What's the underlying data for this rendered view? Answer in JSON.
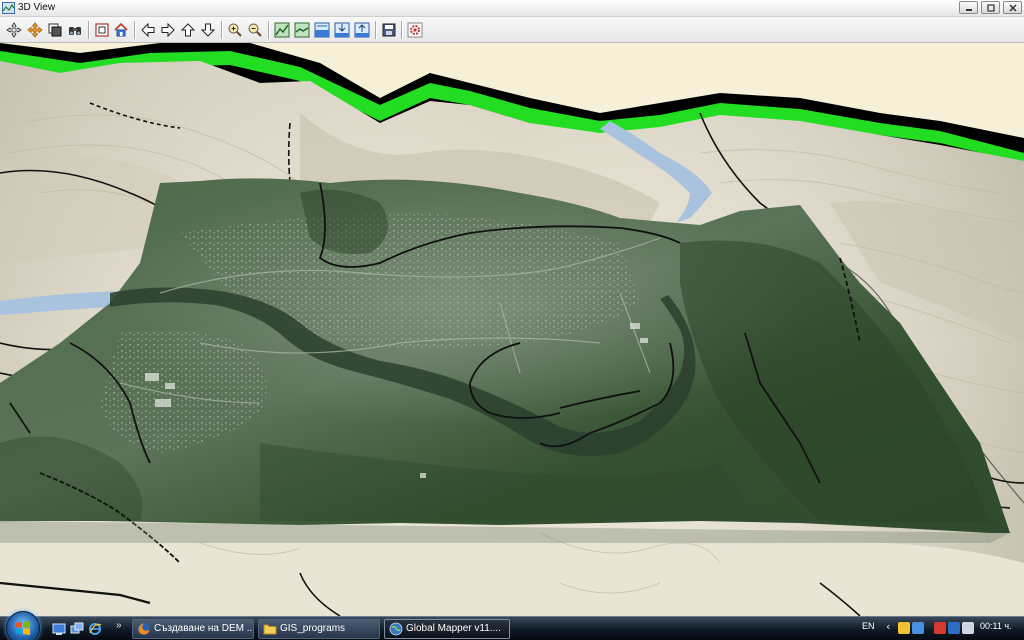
{
  "window": {
    "title": "3D View",
    "controls": [
      "minimize",
      "maximize",
      "close"
    ]
  },
  "toolbar": {
    "buttons": [
      {
        "name": "pan-tool-button",
        "icon": "arrows-move-icon"
      },
      {
        "name": "move-tool-button",
        "icon": "cross-arrows-icon"
      },
      {
        "name": "copy-view-button",
        "icon": "copy-icon"
      },
      {
        "name": "binoculars-button",
        "icon": "binoculars-icon"
      },
      {
        "name": "zoom-extent-button",
        "icon": "zoom-box-icon"
      },
      {
        "name": "home-view-button",
        "icon": "home-icon"
      },
      {
        "name": "pan-left-button",
        "icon": "arrow-left-icon"
      },
      {
        "name": "pan-right-button",
        "icon": "arrow-right-icon"
      },
      {
        "name": "pan-up-button",
        "icon": "arrow-up-icon"
      },
      {
        "name": "pan-down-button",
        "icon": "arrow-down-icon"
      },
      {
        "name": "zoom-in-button",
        "icon": "zoom-in-icon"
      },
      {
        "name": "zoom-out-button",
        "icon": "zoom-out-icon"
      },
      {
        "name": "vertical-exaggeration-up-button",
        "icon": "terrain-up-icon"
      },
      {
        "name": "vertical-exaggeration-down-button",
        "icon": "terrain-down-icon"
      },
      {
        "name": "water-level-button",
        "icon": "water-icon"
      },
      {
        "name": "water-down-button",
        "icon": "water-down-icon"
      },
      {
        "name": "water-up-button",
        "icon": "water-up-icon"
      },
      {
        "name": "save-image-button",
        "icon": "save-icon"
      },
      {
        "name": "settings-button",
        "icon": "gear-icon"
      }
    ]
  },
  "taskbar": {
    "quick_launch": [
      "show-desktop-icon",
      "switch-windows-icon",
      "browser-icon"
    ],
    "more": "»",
    "tasks": [
      {
        "label": "Създаване на DEM ...",
        "icon": "firefox-icon",
        "active": false
      },
      {
        "label": "GIS_programs",
        "icon": "folder-icon",
        "active": false
      },
      {
        "label": "Global Mapper v11....",
        "icon": "globe-icon",
        "active": true
      }
    ],
    "language": "EN",
    "clock": "00:11 ч."
  },
  "colors": {
    "titlebar": "#f0f0f0",
    "terrain": "#e9e3cf",
    "sky": "#f7f0d8",
    "edge_green": "#22dd22",
    "river": "#a9c3df",
    "imagery": "#3e5a3c"
  }
}
